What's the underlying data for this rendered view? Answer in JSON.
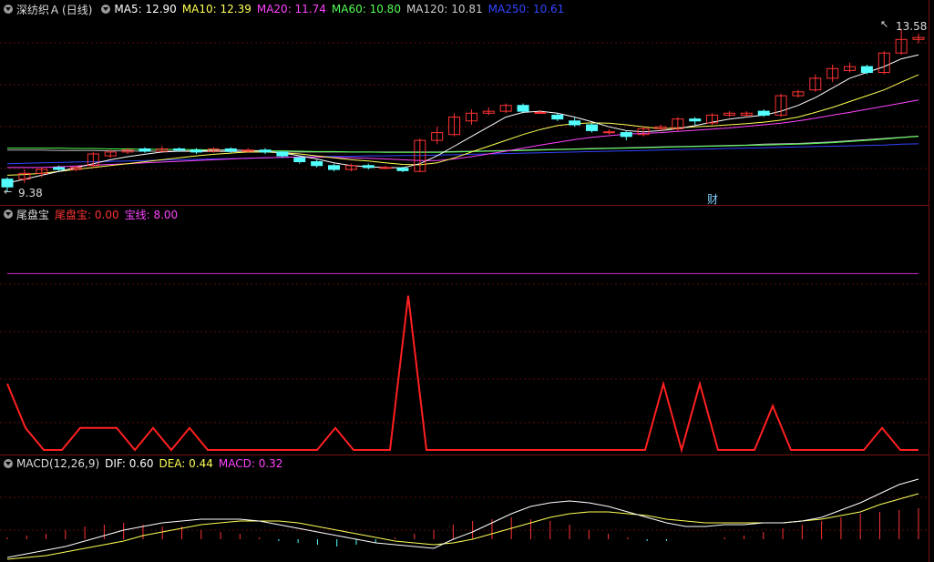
{
  "colors": {
    "up": "#ff3333",
    "down": "#54ffff",
    "ma5": "#ffffff",
    "ma10": "#ffff55",
    "ma20": "#ff44ff",
    "ma60": "#55ff55",
    "ma120": "#bbbbbb",
    "ma250": "#3344ff",
    "grid": "#5a0c0c"
  },
  "main": {
    "stock_name": "深纺织Ａ",
    "period": "(日线)",
    "ma_labels": [
      {
        "key": "ma5",
        "text": "MA5: 12.90"
      },
      {
        "key": "ma10",
        "text": "MA10: 12.39"
      },
      {
        "key": "ma20",
        "text": "MA20: 11.74"
      },
      {
        "key": "ma60",
        "text": "MA60: 10.80"
      },
      {
        "key": "ma120",
        "text": "MA120: 10.81"
      },
      {
        "key": "ma250",
        "text": "MA250: 10.61"
      }
    ],
    "high_label": "13.58",
    "low_label": "9.38",
    "event_marker": "财"
  },
  "indicator": {
    "name": "尾盘宝",
    "line_label": "尾盘宝: 0.00",
    "base_label": "宝线: 8.00"
  },
  "macd": {
    "name": "MACD(12,26,9)",
    "dif_label": "DIF: 0.60",
    "dea_label": "DEA: 0.44",
    "macd_label": "MACD: 0.32"
  },
  "chart_data": {
    "type": "line",
    "candles": {
      "ylim": [
        9.2,
        13.8
      ],
      "bars": [
        [
          9.7,
          9.5,
          9.75,
          9.38
        ],
        [
          9.7,
          9.85,
          9.95,
          9.6
        ],
        [
          9.85,
          9.95,
          10.0,
          9.75
        ],
        [
          10.0,
          9.95,
          10.05,
          9.9
        ],
        [
          9.95,
          10.0,
          10.05,
          9.9
        ],
        [
          10.05,
          10.35,
          10.4,
          10.0
        ],
        [
          10.3,
          10.4,
          10.45,
          10.25
        ],
        [
          10.4,
          10.45,
          10.5,
          10.35
        ],
        [
          10.48,
          10.42,
          10.52,
          10.38
        ],
        [
          10.42,
          10.48,
          10.55,
          10.4
        ],
        [
          10.48,
          10.45,
          10.52,
          10.4
        ],
        [
          10.45,
          10.4,
          10.5,
          10.35
        ],
        [
          10.42,
          10.48,
          10.52,
          10.38
        ],
        [
          10.48,
          10.42,
          10.52,
          10.38
        ],
        [
          10.42,
          10.45,
          10.5,
          10.38
        ],
        [
          10.45,
          10.4,
          10.5,
          10.35
        ],
        [
          10.4,
          10.3,
          10.42,
          10.25
        ],
        [
          10.25,
          10.15,
          10.28,
          10.1
        ],
        [
          10.15,
          10.05,
          10.2,
          10.0
        ],
        [
          10.05,
          9.95,
          10.1,
          9.9
        ],
        [
          9.95,
          10.05,
          10.1,
          9.9
        ],
        [
          10.05,
          10.0,
          10.1,
          9.95
        ],
        [
          10.0,
          10.0,
          10.05,
          9.95
        ],
        [
          9.98,
          9.92,
          10.02,
          9.88
        ],
        [
          9.9,
          10.7,
          10.75,
          9.88
        ],
        [
          10.7,
          10.9,
          11.05,
          10.6
        ],
        [
          10.85,
          11.3,
          11.4,
          10.8
        ],
        [
          11.2,
          11.4,
          11.5,
          11.1
        ],
        [
          11.4,
          11.45,
          11.55,
          11.35
        ],
        [
          11.45,
          11.6,
          11.65,
          11.4
        ],
        [
          11.6,
          11.45,
          11.65,
          11.4
        ],
        [
          11.42,
          11.42,
          11.48,
          11.38
        ],
        [
          11.35,
          11.25,
          11.4,
          11.2
        ],
        [
          11.2,
          11.1,
          11.28,
          11.05
        ],
        [
          11.1,
          10.95,
          11.15,
          10.9
        ],
        [
          10.92,
          10.92,
          10.98,
          10.85
        ],
        [
          10.9,
          10.8,
          10.95,
          10.7
        ],
        [
          10.85,
          11.0,
          11.05,
          10.8
        ],
        [
          11.0,
          11.05,
          11.1,
          10.95
        ],
        [
          11.0,
          11.25,
          11.3,
          10.95
        ],
        [
          11.25,
          11.2,
          11.3,
          11.1
        ],
        [
          11.15,
          11.35,
          11.4,
          11.1
        ],
        [
          11.35,
          11.4,
          11.45,
          11.3
        ],
        [
          11.35,
          11.4,
          11.45,
          11.3
        ],
        [
          11.45,
          11.35,
          11.5,
          11.3
        ],
        [
          11.35,
          11.85,
          11.9,
          11.3
        ],
        [
          11.85,
          11.95,
          12.0,
          11.8
        ],
        [
          12.0,
          12.3,
          12.4,
          11.95
        ],
        [
          12.3,
          12.55,
          12.65,
          12.2
        ],
        [
          12.5,
          12.6,
          12.7,
          12.45
        ],
        [
          12.6,
          12.45,
          12.65,
          12.4
        ],
        [
          12.45,
          12.95,
          13.0,
          12.4
        ],
        [
          12.95,
          13.3,
          13.58,
          12.9
        ],
        [
          13.3,
          13.35,
          13.45,
          13.2
        ]
      ],
      "ma5": [
        9.6,
        9.7,
        9.8,
        9.9,
        10.0,
        10.1,
        10.2,
        10.28,
        10.34,
        10.4,
        10.42,
        10.43,
        10.44,
        10.45,
        10.44,
        10.42,
        10.38,
        10.3,
        10.22,
        10.12,
        10.05,
        10.02,
        10.0,
        9.99,
        10.1,
        10.3,
        10.55,
        10.8,
        11.05,
        11.3,
        11.42,
        11.45,
        11.4,
        11.3,
        11.18,
        11.05,
        10.95,
        10.92,
        10.95,
        11.0,
        11.08,
        11.17,
        11.25,
        11.3,
        11.35,
        11.45,
        11.6,
        11.8,
        12.05,
        12.3,
        12.45,
        12.6,
        12.8,
        12.9
      ],
      "ma10": [
        9.8,
        9.82,
        9.85,
        9.9,
        9.95,
        10.0,
        10.05,
        10.1,
        10.15,
        10.2,
        10.25,
        10.3,
        10.34,
        10.37,
        10.4,
        10.4,
        10.38,
        10.35,
        10.3,
        10.25,
        10.2,
        10.17,
        10.12,
        10.08,
        10.07,
        10.12,
        10.25,
        10.4,
        10.55,
        10.7,
        10.85,
        10.98,
        11.08,
        11.13,
        11.15,
        11.14,
        11.1,
        11.05,
        11.0,
        11.02,
        11.05,
        11.07,
        11.1,
        11.13,
        11.17,
        11.22,
        11.3,
        11.42,
        11.55,
        11.7,
        11.85,
        12.0,
        12.2,
        12.39
      ],
      "ma20": [
        10.0,
        10.0,
        10.0,
        10.02,
        10.04,
        10.06,
        10.08,
        10.1,
        10.12,
        10.14,
        10.16,
        10.18,
        10.2,
        10.22,
        10.24,
        10.25,
        10.26,
        10.27,
        10.27,
        10.26,
        10.25,
        10.24,
        10.22,
        10.2,
        10.18,
        10.18,
        10.22,
        10.28,
        10.35,
        10.42,
        10.5,
        10.58,
        10.65,
        10.72,
        10.78,
        10.82,
        10.86,
        10.88,
        10.9,
        10.93,
        10.96,
        10.99,
        11.02,
        11.06,
        11.1,
        11.14,
        11.2,
        11.27,
        11.35,
        11.42,
        11.5,
        11.58,
        11.66,
        11.74
      ],
      "ma60": [
        10.5,
        10.5,
        10.5,
        10.5,
        10.49,
        10.49,
        10.48,
        10.48,
        10.47,
        10.47,
        10.46,
        10.46,
        10.45,
        10.45,
        10.44,
        10.43,
        10.43,
        10.42,
        10.41,
        10.41,
        10.4,
        10.4,
        10.39,
        10.39,
        10.39,
        10.39,
        10.4,
        10.41,
        10.42,
        10.43,
        10.44,
        10.45,
        10.46,
        10.47,
        10.48,
        10.49,
        10.5,
        10.51,
        10.52,
        10.53,
        10.54,
        10.55,
        10.56,
        10.57,
        10.58,
        10.59,
        10.6,
        10.62,
        10.64,
        10.67,
        10.7,
        10.73,
        10.77,
        10.8
      ],
      "ma120": [
        10.45,
        10.45,
        10.45,
        10.44,
        10.44,
        10.44,
        10.43,
        10.43,
        10.42,
        10.42,
        10.42,
        10.41,
        10.41,
        10.41,
        10.4,
        10.4,
        10.4,
        10.4,
        10.4,
        10.4,
        10.4,
        10.4,
        10.4,
        10.4,
        10.4,
        10.4,
        10.41,
        10.42,
        10.43,
        10.44,
        10.45,
        10.46,
        10.47,
        10.48,
        10.49,
        10.5,
        10.51,
        10.52,
        10.53,
        10.54,
        10.55,
        10.56,
        10.57,
        10.58,
        10.6,
        10.61,
        10.62,
        10.64,
        10.66,
        10.69,
        10.72,
        10.75,
        10.78,
        10.81
      ],
      "ma250": [
        10.1,
        10.11,
        10.12,
        10.13,
        10.14,
        10.15,
        10.16,
        10.17,
        10.18,
        10.19,
        10.2,
        10.21,
        10.22,
        10.23,
        10.24,
        10.25,
        10.26,
        10.27,
        10.28,
        10.29,
        10.29,
        10.3,
        10.3,
        10.31,
        10.31,
        10.32,
        10.33,
        10.34,
        10.35,
        10.36,
        10.37,
        10.38,
        10.39,
        10.4,
        10.41,
        10.42,
        10.43,
        10.44,
        10.45,
        10.46,
        10.47,
        10.48,
        10.49,
        10.5,
        10.51,
        10.52,
        10.53,
        10.54,
        10.55,
        10.56,
        10.57,
        10.58,
        10.6,
        10.61
      ]
    },
    "tail_indicator": {
      "ylim": [
        0,
        10
      ],
      "base": 8.0,
      "values": [
        3,
        1,
        0,
        0,
        1,
        1,
        1,
        0,
        1,
        0,
        1,
        0,
        0,
        0,
        0,
        0,
        0,
        0,
        1,
        0,
        0,
        0,
        7,
        0,
        0,
        0,
        0,
        0,
        0,
        0,
        0,
        0,
        0,
        0,
        0,
        0,
        3,
        0,
        3,
        0,
        0,
        0,
        2,
        0,
        0,
        0,
        0,
        0,
        1,
        0,
        0
      ]
    },
    "macd": {
      "ylim": [
        -0.12,
        0.36
      ],
      "dif": [
        -0.1,
        -0.08,
        -0.06,
        -0.04,
        -0.01,
        0.02,
        0.05,
        0.07,
        0.09,
        0.1,
        0.11,
        0.11,
        0.11,
        0.1,
        0.08,
        0.06,
        0.04,
        0.02,
        0.0,
        -0.02,
        -0.03,
        -0.04,
        -0.05,
        0.0,
        0.04,
        0.09,
        0.14,
        0.18,
        0.2,
        0.21,
        0.2,
        0.18,
        0.15,
        0.12,
        0.09,
        0.07,
        0.07,
        0.08,
        0.08,
        0.09,
        0.09,
        0.1,
        0.12,
        0.16,
        0.2,
        0.25,
        0.3,
        0.33
      ],
      "dea": [
        -0.11,
        -0.1,
        -0.09,
        -0.07,
        -0.05,
        -0.03,
        -0.01,
        0.02,
        0.04,
        0.06,
        0.08,
        0.09,
        0.1,
        0.1,
        0.1,
        0.09,
        0.07,
        0.05,
        0.03,
        0.01,
        -0.01,
        -0.02,
        -0.03,
        -0.02,
        0.0,
        0.03,
        0.06,
        0.09,
        0.12,
        0.14,
        0.15,
        0.15,
        0.14,
        0.13,
        0.11,
        0.1,
        0.09,
        0.09,
        0.09,
        0.09,
        0.09,
        0.1,
        0.11,
        0.13,
        0.15,
        0.19,
        0.22,
        0.25
      ],
      "hist": [
        0.01,
        0.02,
        0.03,
        0.05,
        0.07,
        0.08,
        0.09,
        0.08,
        0.07,
        0.07,
        0.05,
        0.04,
        0.03,
        0.01,
        -0.01,
        -0.02,
        -0.03,
        -0.04,
        -0.03,
        -0.02,
        0.01,
        0.03,
        0.05,
        0.08,
        0.1,
        0.11,
        0.12,
        0.11,
        0.1,
        0.08,
        0.05,
        0.03,
        0.01,
        -0.01,
        -0.01,
        0.0,
        0.0,
        0.01,
        0.02,
        0.04,
        0.06,
        0.08,
        0.1,
        0.12,
        0.14,
        0.15,
        0.16,
        0.17
      ]
    }
  }
}
